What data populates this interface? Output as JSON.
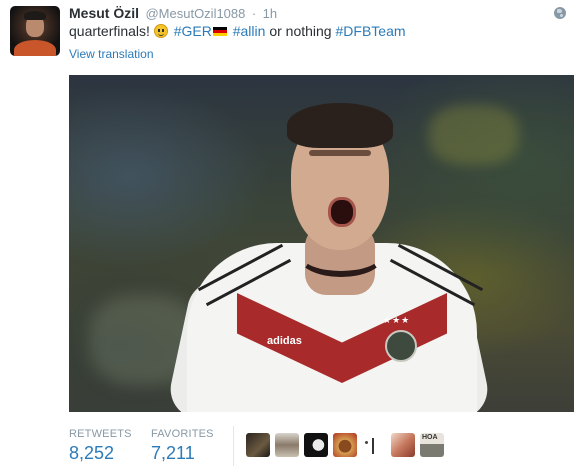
{
  "tweet": {
    "fullname": "Mesut Özil",
    "username": "@MesutOzil1088",
    "separator": "·",
    "time": "1h",
    "text": {
      "part1": "quarterfinals!",
      "hashtag_ger": "#GER",
      "hashtag_allin": "#allin",
      "part2": "or nothing",
      "hashtag_dfb": "#DFBTeam"
    },
    "emoji": [
      "smiley-icon",
      "german-flag-icon"
    ],
    "translate_label": "View translation",
    "photo_text": {
      "brand": "adidas",
      "stars": "★★★"
    }
  },
  "stats": {
    "retweets_label": "RETWEETS",
    "retweets_value": "8,252",
    "favorites_label": "FAVORITES",
    "favorites_value": "7,211"
  },
  "favoriters_overlay_text": "HOA",
  "colors": {
    "link": "#2b7bb9",
    "muted": "#8899a6",
    "text": "#292f33"
  }
}
